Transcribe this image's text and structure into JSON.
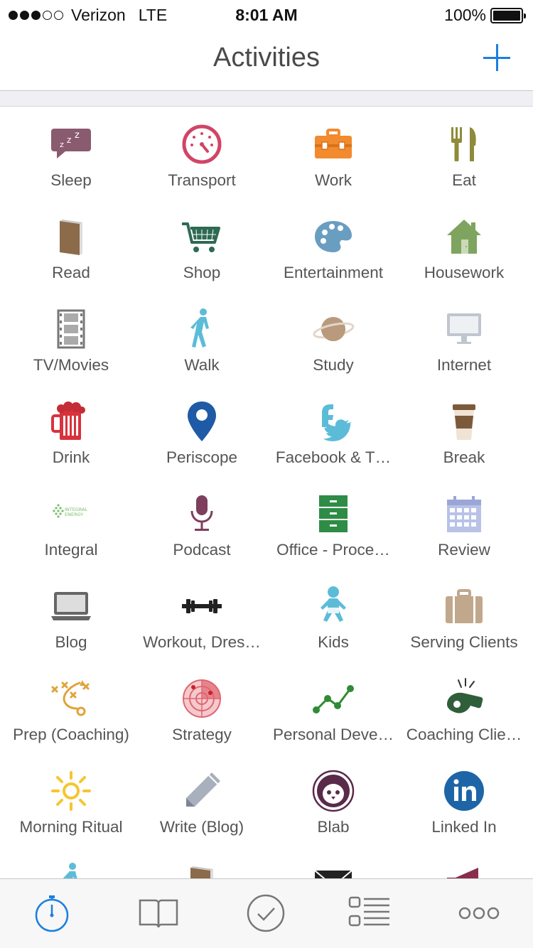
{
  "status_bar": {
    "carrier": "Verizon",
    "network": "LTE",
    "time": "8:01 AM",
    "battery": "100%"
  },
  "nav": {
    "title": "Activities",
    "add_icon": "plus-icon",
    "accent_color": "#1a7fe0"
  },
  "activities": [
    {
      "label": "Sleep",
      "icon": "sleep-icon"
    },
    {
      "label": "Transport",
      "icon": "speedometer-icon"
    },
    {
      "label": "Work",
      "icon": "toolbox-icon"
    },
    {
      "label": "Eat",
      "icon": "fork-knife-icon"
    },
    {
      "label": "Read",
      "icon": "book-icon"
    },
    {
      "label": "Shop",
      "icon": "shopping-cart-icon"
    },
    {
      "label": "Entertainment",
      "icon": "palette-icon"
    },
    {
      "label": "Housework",
      "icon": "house-icon"
    },
    {
      "label": "TV/Movies",
      "icon": "film-strip-icon"
    },
    {
      "label": "Walk",
      "icon": "walking-person-icon"
    },
    {
      "label": "Study",
      "icon": "planet-icon"
    },
    {
      "label": "Internet",
      "icon": "monitor-icon"
    },
    {
      "label": "Drink",
      "icon": "beer-mug-icon"
    },
    {
      "label": "Periscope",
      "icon": "map-pin-icon"
    },
    {
      "label": "Facebook & T…",
      "icon": "facebook-twitter-icon"
    },
    {
      "label": "Break",
      "icon": "coffee-cup-icon"
    },
    {
      "label": "Integral",
      "icon": "integral-energy-logo-icon"
    },
    {
      "label": "Podcast",
      "icon": "microphone-icon"
    },
    {
      "label": "Office - Proce…",
      "icon": "filing-cabinet-icon"
    },
    {
      "label": "Review",
      "icon": "calendar-icon"
    },
    {
      "label": "Blog",
      "icon": "laptop-icon"
    },
    {
      "label": "Workout, Dres…",
      "icon": "dumbbell-icon"
    },
    {
      "label": "Kids",
      "icon": "baby-icon"
    },
    {
      "label": "Serving Clients",
      "icon": "briefcase-icon"
    },
    {
      "label": "Prep (Coaching)",
      "icon": "play-diagram-icon"
    },
    {
      "label": "Strategy",
      "icon": "radar-icon"
    },
    {
      "label": "Personal Deve…",
      "icon": "line-graph-icon"
    },
    {
      "label": "Coaching Clie…",
      "icon": "whistle-icon"
    },
    {
      "label": "Morning Ritual",
      "icon": "sun-icon"
    },
    {
      "label": "Write (Blog)",
      "icon": "pencil-icon"
    },
    {
      "label": "Blab",
      "icon": "blab-owl-icon"
    },
    {
      "label": "Linked In",
      "icon": "linkedin-icon"
    },
    {
      "label": "",
      "icon": "walking-person-icon"
    },
    {
      "label": "",
      "icon": "book-icon"
    },
    {
      "label": "",
      "icon": "envelope-icon"
    },
    {
      "label": "",
      "icon": "megaphone-icon"
    }
  ],
  "tab_bar": [
    {
      "icon": "stopwatch-icon",
      "active": true
    },
    {
      "icon": "open-book-icon",
      "active": false
    },
    {
      "icon": "checkmark-circle-icon",
      "active": false
    },
    {
      "icon": "list-icon",
      "active": false
    },
    {
      "icon": "more-dots-icon",
      "active": false
    }
  ]
}
